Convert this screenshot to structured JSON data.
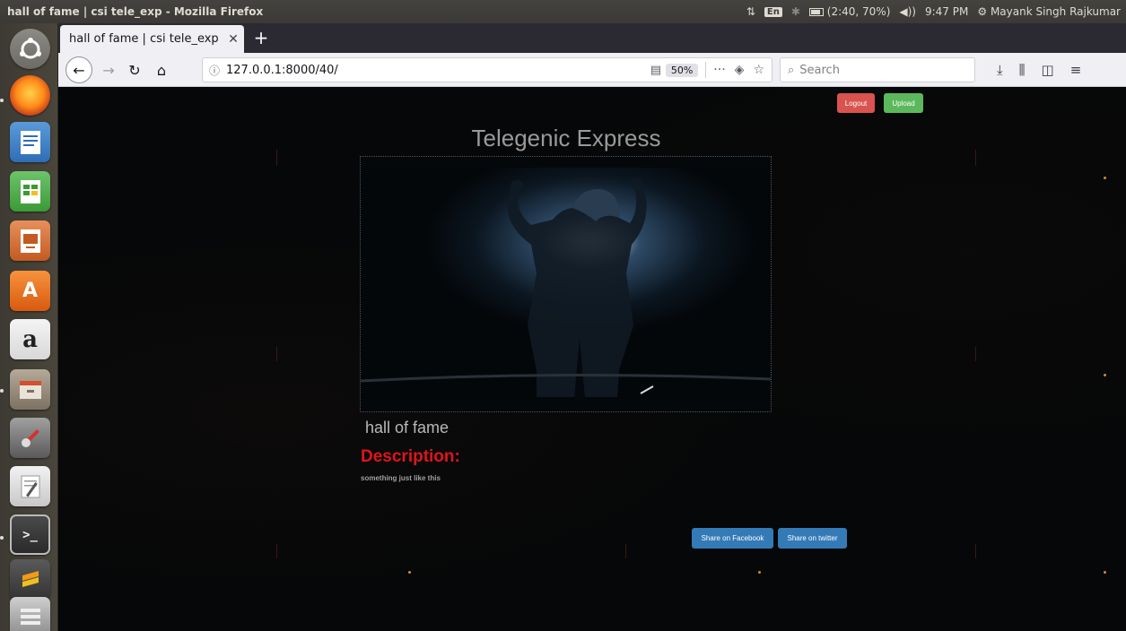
{
  "topbar": {
    "window_title": "hall of fame | csi tele_exp - Mozilla Firefox",
    "keyboard_layout": "En",
    "battery_text": "(2:40, 70%)",
    "battery_level": 0.7,
    "time": "9:47 PM",
    "user_name": "Mayank Singh Rajkumar"
  },
  "browser": {
    "tab_title": "hall of fame | csi tele_exp",
    "url": "127.0.0.1:8000/40/",
    "zoom": "50%",
    "search_placeholder": "Search"
  },
  "page": {
    "logout_label": "Logout",
    "upload_label": "Upload",
    "site_title": "Telegenic Express",
    "post_title": "hall of fame",
    "description_heading": "Description:",
    "description_text": "something just like this",
    "share_facebook_label": "Share on Facebook",
    "share_twitter_label": "Share on twitter"
  },
  "colors": {
    "logout": "#d9534f",
    "upload": "#5cb85c",
    "share": "#337ab7",
    "description_heading": "#e0141b"
  },
  "launcher": {
    "icons": [
      "ubuntu-dash-icon",
      "firefox-icon",
      "libreoffice-writer-icon",
      "libreoffice-calc-icon",
      "libreoffice-impress-icon",
      "software-center-icon",
      "amazon-icon",
      "file-manager-icon",
      "system-settings-icon",
      "text-editor-icon",
      "terminal-icon",
      "sublime-text-icon",
      "disks-icon"
    ],
    "amazon_glyph": "a"
  }
}
